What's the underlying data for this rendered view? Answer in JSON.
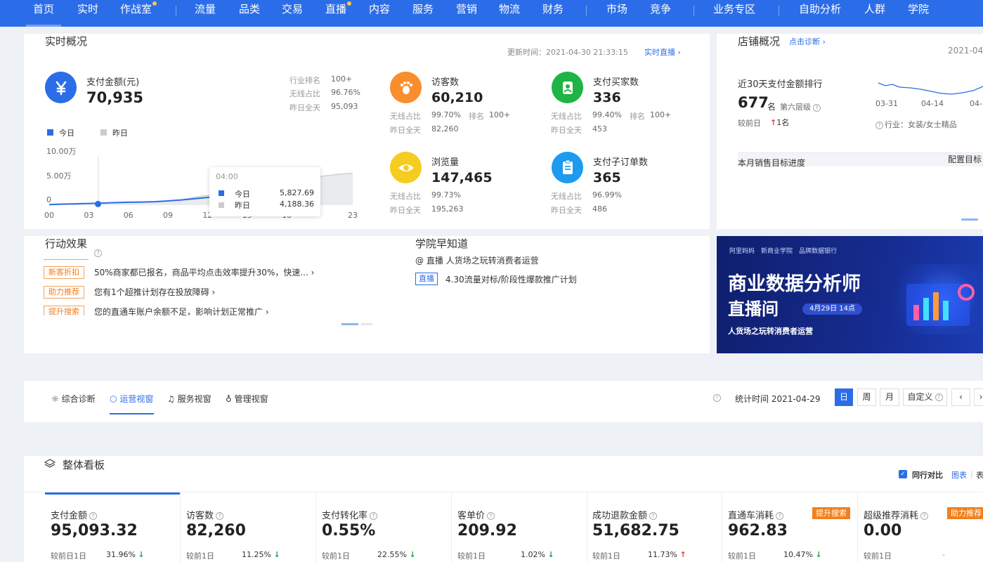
{
  "nav": {
    "items": [
      "首页",
      "实时",
      "作战室",
      "流量",
      "品类",
      "交易",
      "直播",
      "内容",
      "服务",
      "营销",
      "物流",
      "财务",
      "市场",
      "竞争",
      "业务专区",
      "自助分析",
      "人群",
      "学院"
    ]
  },
  "realtime": {
    "title": "实时概况",
    "update_label": "更新时间：2021-04-30 21:33:15",
    "live_link": "实时直播",
    "pay": {
      "label": "支付金额(元)",
      "value": "70,935",
      "rank_label": "行业排名",
      "rank_value": "100+",
      "wireless_label": "无线占比",
      "wireless_value": "96.76%",
      "yesterday_label": "昨日全天",
      "yesterday_value": "95,093"
    },
    "legend": {
      "today": "今日",
      "yesterday": "昨日"
    },
    "tooltip": {
      "time": "04:00",
      "today_label": "今日",
      "today_value": "5,827.69",
      "yday_label": "昨日",
      "yday_value": "4,188.36"
    },
    "kpis": [
      {
        "label": "访客数",
        "value": "60,210",
        "l1": "无线占比",
        "v1": "99.70%",
        "l2": "排名",
        "v2": "100+",
        "l3": "昨日全天",
        "v3": "82,260"
      },
      {
        "label": "支付买家数",
        "value": "336",
        "l1": "无线占比",
        "v1": "99.40%",
        "l2": "排名",
        "v2": "100+",
        "l3": "昨日全天",
        "v3": "453"
      },
      {
        "label": "浏览量",
        "value": "147,465",
        "l1": "无线占比",
        "v1": "99.73%",
        "l3": "昨日全天",
        "v3": "195,263"
      },
      {
        "label": "支付子订单数",
        "value": "365",
        "l1": "无线占比",
        "v1": "96.99%",
        "l3": "昨日全天",
        "v3": "486"
      }
    ]
  },
  "chart_data": {
    "type": "line",
    "x": [
      "00",
      "03",
      "06",
      "09",
      "12",
      "15",
      "18",
      "23"
    ],
    "xticks": [
      "00",
      "03",
      "06",
      "09",
      "12",
      "15",
      "18",
      "23"
    ],
    "yticks": [
      "10.00万",
      "5.00万",
      "0"
    ],
    "ylim": [
      0,
      100000
    ],
    "series": [
      {
        "name": "今日",
        "x": [
          0,
          1,
          2,
          3,
          4,
          5,
          6,
          7,
          8,
          9,
          10,
          11,
          12,
          13,
          14,
          15,
          16,
          17,
          18
        ],
        "values": [
          1200,
          2100,
          2700,
          3400,
          4100,
          5200,
          5800,
          6300,
          7000,
          8600,
          10500,
          13000,
          15500,
          19000,
          23000,
          29000,
          34000,
          38000,
          41000
        ]
      },
      {
        "name": "昨日",
        "x": [
          0,
          2,
          4,
          6,
          8,
          10,
          11,
          12,
          13,
          14,
          15,
          16,
          17,
          18,
          19,
          20,
          21,
          22,
          23
        ],
        "values": [
          1000,
          2000,
          4200,
          5000,
          6500,
          9800,
          16000,
          20000,
          22500,
          25000,
          30000,
          36000,
          43000,
          48000,
          51000,
          56000,
          60000,
          63000,
          65000
        ]
      }
    ]
  },
  "shop": {
    "title": "店铺概况",
    "diag_link": "点击诊断",
    "date": "2021-04",
    "rank_label": "近30天支付金额排行",
    "rank_value": "677",
    "rank_unit": "名",
    "tier": "第六层级",
    "compare": "较前日",
    "change": "1名",
    "dates": [
      "03-31",
      "04-14",
      "04-"
    ],
    "industry": "行业：女装/女士精品",
    "target_label": "本月销售目标进度",
    "target_btn": "配置目标"
  },
  "action": {
    "title": "行动效果",
    "items": [
      {
        "tag": "新客折扣",
        "text": "50%商家都已报名，商品平均点击效率提升30%，快速..."
      },
      {
        "tag": "助力推荐",
        "text": "您有1个超推计划存在投放障碍"
      },
      {
        "tag": "提升搜索",
        "text": "您的直通车账户余额不足，影响计划正常推广"
      }
    ]
  },
  "academy": {
    "title": "学院早知道",
    "line1": "@ 直播 人货场之玩转消费者运营",
    "tag": "直播",
    "line2": "4.30流量对标/阶段性爆款推广计划"
  },
  "banner": {
    "logos": [
      "阿里妈妈",
      "新商业学院",
      "品牌数据银行"
    ],
    "title": "商业数据分析师",
    "subtitle": "直播间",
    "date_badge": "4月29日 14点",
    "tagline": "人货场之玩转消费者运营"
  },
  "tabs": {
    "items": [
      "综合诊断",
      "运营视窗",
      "服务视窗",
      "管理视窗"
    ],
    "stat_label": "统计时间 2021-04-29",
    "periods": [
      "日",
      "周",
      "月",
      "自定义"
    ]
  },
  "board": {
    "title": "整体看板",
    "compare_label": "同行对比",
    "view_chart": "图表",
    "view_table": "表",
    "metrics": [
      {
        "label": "支付金额",
        "value": "95,093.32",
        "cmp": "较前日1日",
        "pct": "31.96%",
        "dir": "down"
      },
      {
        "label": "访客数",
        "value": "82,260",
        "cmp": "较前1日",
        "pct": "11.25%",
        "dir": "down"
      },
      {
        "label": "支付转化率",
        "value": "0.55%",
        "cmp": "较前1日",
        "pct": "22.55%",
        "dir": "down"
      },
      {
        "label": "客单价",
        "value": "209.92",
        "cmp": "较前1日",
        "pct": "1.02%",
        "dir": "down"
      },
      {
        "label": "成功退款金额",
        "value": "51,682.75",
        "cmp": "较前1日",
        "pct": "11.73%",
        "dir": "up"
      },
      {
        "label": "直通车消耗",
        "value": "962.83",
        "cmp": "较前1日",
        "pct": "10.47%",
        "dir": "down",
        "badge": "提升搜索"
      },
      {
        "label": "超级推荐消耗",
        "value": "0.00",
        "cmp": "较前1日",
        "pct": "-",
        "dir": "none",
        "badge": "助力推荐"
      }
    ]
  },
  "colors": {
    "brand": "#2b6de8",
    "orange": "#f07c1c",
    "green": "#1aa34a",
    "red": "#e23a3a"
  }
}
